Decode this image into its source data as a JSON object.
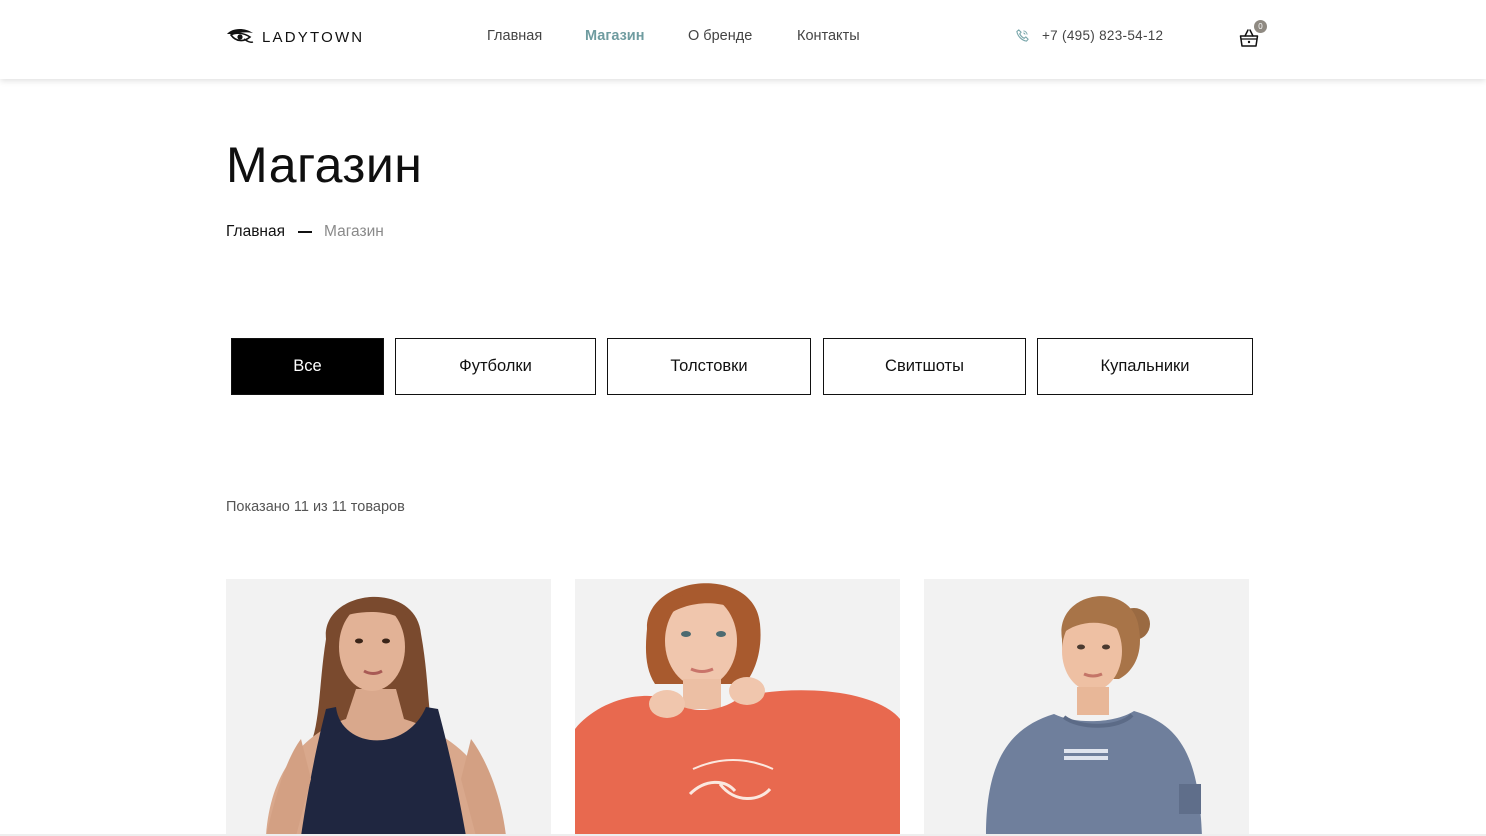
{
  "brand": {
    "name": "LADYTOWN",
    "logo_icon": "eye-icon"
  },
  "nav": {
    "items": [
      {
        "label": "Главная",
        "active": false
      },
      {
        "label": "Магазин",
        "active": true
      },
      {
        "label": "О бренде",
        "active": false
      },
      {
        "label": "Контакты",
        "active": false
      }
    ],
    "active_color": "#6f9ca0"
  },
  "contact": {
    "phone": "+7 (495) 823-54-12",
    "icon": "phone-icon"
  },
  "cart": {
    "count": "0",
    "icon": "shopping-basket-icon",
    "badge_color": "#8f8a82"
  },
  "page": {
    "title": "Магазин",
    "breadcrumb": {
      "home": "Главная",
      "current": "Магазин"
    }
  },
  "filters": [
    {
      "label": "Все",
      "active": true
    },
    {
      "label": "Футболки",
      "active": false
    },
    {
      "label": "Толстовки",
      "active": false
    },
    {
      "label": "Свитшоты",
      "active": false
    },
    {
      "label": "Купальники",
      "active": false
    }
  ],
  "results_text": "Показано 11 из 11 товаров",
  "products": [
    {
      "image": "woman-in-navy-swimsuit",
      "garment_color": "#1f2640"
    },
    {
      "image": "woman-in-coral-sweatshirt",
      "garment_color": "#e8694f"
    },
    {
      "image": "woman-in-blue-grey-sweatshirt",
      "garment_color": "#6f7f9c"
    }
  ]
}
